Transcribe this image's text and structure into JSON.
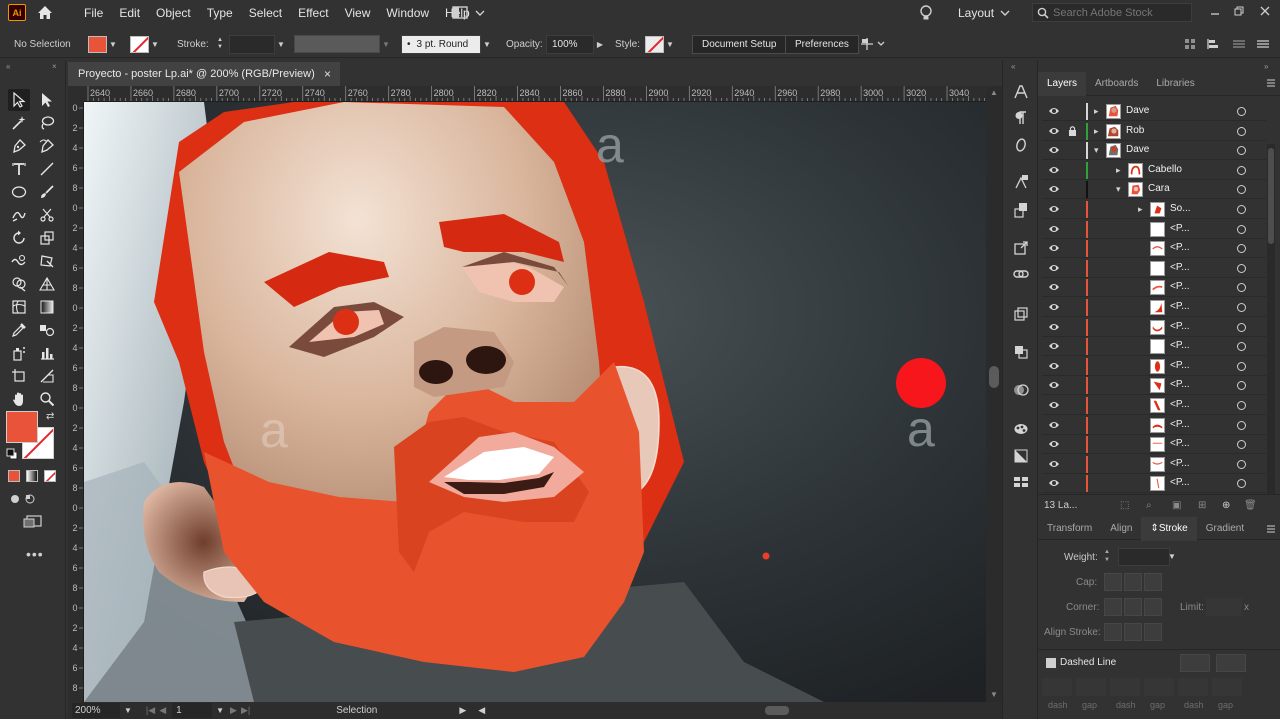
{
  "app": {
    "logo_text": "Ai",
    "menu": [
      "File",
      "Edit",
      "Object",
      "Type",
      "Select",
      "Effect",
      "View",
      "Window",
      "Help"
    ],
    "layout_label": "Layout",
    "search_placeholder": "Search Adobe Stock"
  },
  "control_bar": {
    "selection_label": "No Selection",
    "stroke_label": "Stroke:",
    "brush_value": "3 pt. Round",
    "opacity_label": "Opacity:",
    "opacity_value": "100%",
    "style_label": "Style:",
    "document_setup": "Document Setup",
    "preferences": "Preferences",
    "fill_color": "#e8533a"
  },
  "document": {
    "tab_title": "Proyecto - poster Lp.ai* @ 200% (RGB/Preview)",
    "close_symbol": "×",
    "zoom": "200%",
    "artboard_number": "1",
    "status_text": "Selection",
    "ruler_h": [
      "2640",
      "2660",
      "2680",
      "2700",
      "2720",
      "2740",
      "2760",
      "2780",
      "2800",
      "2820",
      "2840",
      "2860",
      "2880",
      "2900",
      "2920",
      "2940",
      "2960",
      "2980",
      "3000",
      "3020",
      "3040"
    ],
    "ruler_v": [
      "0",
      "2",
      "4",
      "6",
      "8",
      "0",
      "2",
      "4",
      "6",
      "8",
      "0",
      "2",
      "4",
      "6",
      "8",
      "0",
      "2",
      "4",
      "6",
      "8",
      "0",
      "2",
      "4",
      "6",
      "8",
      "0",
      "2",
      "4",
      "6",
      "8"
    ]
  },
  "canvas": {
    "placeholder_glyph": "a"
  },
  "layers_panel": {
    "tabs": [
      "Layers",
      "Artboards",
      "Libraries"
    ],
    "footer_count": "13 La...",
    "rows": [
      {
        "name": "Dave",
        "indent": 0,
        "expanded": false,
        "locked": false,
        "color": "#d6d6d6"
      },
      {
        "name": "Rob",
        "indent": 0,
        "expanded": false,
        "locked": true,
        "color": "#2fa23b"
      },
      {
        "name": "Dave",
        "indent": 0,
        "expanded": true,
        "locked": false,
        "color": "#d6d6d6"
      },
      {
        "name": "Cabello",
        "indent": 1,
        "expanded": false,
        "locked": false,
        "color": "#2fa23b"
      },
      {
        "name": "Cara",
        "indent": 1,
        "expanded": true,
        "locked": false,
        "color": "#111111"
      },
      {
        "name": "So...",
        "indent": 2,
        "expanded": false,
        "locked": false,
        "color": "#e8533a"
      },
      {
        "name": "<P...",
        "indent": 3,
        "expanded": null,
        "locked": false,
        "color": "#e8533a"
      },
      {
        "name": "<P...",
        "indent": 3,
        "expanded": null,
        "locked": false,
        "color": "#e8533a"
      },
      {
        "name": "<P...",
        "indent": 3,
        "expanded": null,
        "locked": false,
        "color": "#e8533a"
      },
      {
        "name": "<P...",
        "indent": 3,
        "expanded": null,
        "locked": false,
        "color": "#e8533a"
      },
      {
        "name": "<P...",
        "indent": 3,
        "expanded": null,
        "locked": false,
        "color": "#e8533a"
      },
      {
        "name": "<P...",
        "indent": 3,
        "expanded": null,
        "locked": false,
        "color": "#e8533a"
      },
      {
        "name": "<P...",
        "indent": 3,
        "expanded": null,
        "locked": false,
        "color": "#e8533a"
      },
      {
        "name": "<P...",
        "indent": 3,
        "expanded": null,
        "locked": false,
        "color": "#e8533a"
      },
      {
        "name": "<P...",
        "indent": 3,
        "expanded": null,
        "locked": false,
        "color": "#e8533a"
      },
      {
        "name": "<P...",
        "indent": 3,
        "expanded": null,
        "locked": false,
        "color": "#e8533a"
      },
      {
        "name": "<P...",
        "indent": 3,
        "expanded": null,
        "locked": false,
        "color": "#e8533a"
      },
      {
        "name": "<P...",
        "indent": 3,
        "expanded": null,
        "locked": false,
        "color": "#e8533a"
      },
      {
        "name": "<P...",
        "indent": 3,
        "expanded": null,
        "locked": false,
        "color": "#e8533a"
      },
      {
        "name": "<P...",
        "indent": 3,
        "expanded": null,
        "locked": false,
        "color": "#e8533a"
      }
    ]
  },
  "stroke_panel": {
    "tabs": [
      "Transform",
      "Align",
      "Stroke",
      "Gradient"
    ],
    "weight_label": "Weight:",
    "cap_label": "Cap:",
    "corner_label": "Corner:",
    "limit_label": "Limit:",
    "limit_suffix": "x",
    "align_label": "Align Stroke:",
    "dashed_label": "Dashed Line",
    "dash_labels": [
      "dash",
      "gap",
      "dash",
      "gap",
      "dash",
      "gap"
    ]
  }
}
